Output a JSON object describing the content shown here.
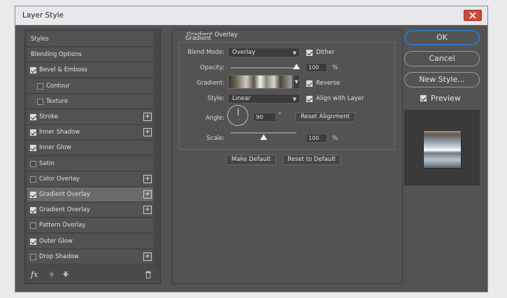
{
  "window": {
    "title": "Layer Style"
  },
  "styles_list": {
    "items": [
      {
        "label": "Styles",
        "checkbox": false,
        "checked": false,
        "plus": false,
        "selected": false
      },
      {
        "label": "Blending Options",
        "checkbox": false,
        "checked": false,
        "plus": false,
        "selected": false
      },
      {
        "label": "Bevel & Emboss",
        "checkbox": true,
        "checked": true,
        "plus": false,
        "selected": false
      },
      {
        "label": "Contour",
        "checkbox": true,
        "checked": false,
        "plus": false,
        "selected": false,
        "indent": true
      },
      {
        "label": "Texture",
        "checkbox": true,
        "checked": false,
        "plus": false,
        "selected": false,
        "indent": true
      },
      {
        "label": "Stroke",
        "checkbox": true,
        "checked": true,
        "plus": true,
        "selected": false
      },
      {
        "label": "Inner Shadow",
        "checkbox": true,
        "checked": true,
        "plus": true,
        "selected": false
      },
      {
        "label": "Inner Glow",
        "checkbox": true,
        "checked": true,
        "plus": false,
        "selected": false
      },
      {
        "label": "Satin",
        "checkbox": true,
        "checked": false,
        "plus": false,
        "selected": false
      },
      {
        "label": "Color Overlay",
        "checkbox": true,
        "checked": false,
        "plus": true,
        "selected": false
      },
      {
        "label": "Gradient Overlay",
        "checkbox": true,
        "checked": true,
        "plus": true,
        "selected": true
      },
      {
        "label": "Gradient Overlay",
        "checkbox": true,
        "checked": true,
        "plus": true,
        "selected": false
      },
      {
        "label": "Pattern Overlay",
        "checkbox": true,
        "checked": false,
        "plus": false,
        "selected": false
      },
      {
        "label": "Outer Glow",
        "checkbox": true,
        "checked": true,
        "plus": false,
        "selected": false
      },
      {
        "label": "Drop Shadow",
        "checkbox": true,
        "checked": false,
        "plus": true,
        "selected": false
      }
    ],
    "plus_glyph": "+",
    "fx_label": "fx"
  },
  "gradient_overlay": {
    "title": "Gradient Overlay",
    "subtitle": "Gradient",
    "blend_mode_label": "Blend Mode:",
    "blend_mode_value": "Overlay",
    "dither_label": "Dither",
    "dither_checked": true,
    "opacity_label": "Opacity:",
    "opacity_value": "100",
    "opacity_level": 1.0,
    "percent": "%",
    "gradient_label": "Gradient:",
    "reverse_label": "Reverse",
    "reverse_checked": true,
    "style_label": "Style:",
    "style_value": "Linear",
    "align_label": "Align with Layer",
    "align_checked": true,
    "angle_label": "Angle:",
    "angle_value": "90",
    "degree": "°",
    "reset_alignment_label": "Reset Alignment",
    "scale_label": "Scale:",
    "scale_value": "100",
    "scale_level": 0.5,
    "make_default_label": "Make Default",
    "reset_default_label": "Reset to Default"
  },
  "actions": {
    "ok_label": "OK",
    "cancel_label": "Cancel",
    "new_style_label": "New Style...",
    "preview_label": "Preview",
    "preview_checked": true
  },
  "colors": {
    "accent": "#2d76c8",
    "close": "#c94a3c",
    "panel": "#535353"
  }
}
